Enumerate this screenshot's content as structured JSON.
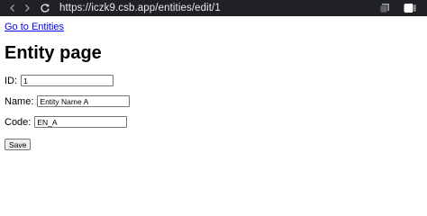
{
  "browser": {
    "url": "https://iczk9.csb.app/entities/edit/1"
  },
  "page": {
    "back_link": "Go to Entities",
    "title": "Entity page",
    "fields": {
      "id_label": "ID:",
      "id_value": "1",
      "name_label": "Name:",
      "name_value": "Entity Name A",
      "code_label": "Code:",
      "code_value": "EN_A"
    },
    "save_label": "Save"
  },
  "icons": {
    "back": "arrow-left-icon",
    "forward": "arrow-right-icon",
    "reload": "reload-icon",
    "extensions": "tabs-stack-icon",
    "profile": "window-toggle-icon"
  },
  "colors": {
    "topbar": "#202124",
    "link": "#0000ee"
  }
}
